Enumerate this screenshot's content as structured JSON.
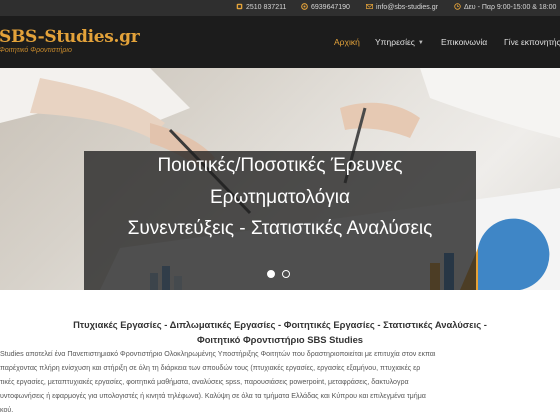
{
  "topbar": {
    "phone1": "2510 837211",
    "phone2": "6939647190",
    "email": "info@sbs-studies.gr",
    "hours": "Δευ - Παρ 9:00-15:00 & 18:00",
    "icons": [
      "phone-icon",
      "whatsapp-icon",
      "mail-icon",
      "clock-icon"
    ]
  },
  "logo": {
    "title": "SBS-Studies.gr",
    "subtitle": "Φοιτητικό Φροντιστήριο"
  },
  "nav": {
    "items": [
      {
        "label": "Αρχική",
        "active": true
      },
      {
        "label": "Υπηρεσίες",
        "dropdown": true
      },
      {
        "label": "Επικοινωνία"
      },
      {
        "label": "Γίνε εκπονητής"
      }
    ]
  },
  "hero": {
    "lines": [
      "Ποιοτικές/Ποσοτικές Έρευνες",
      "Ερωτηματολόγια",
      "Συνεντεύξεις - Στατιστικές Αναλύσεις"
    ],
    "slide_count": 2,
    "active_slide": 1
  },
  "content": {
    "headline_line1": "Πτυχιακές Εργασίες - Διπλωματικές Εργασίες - Φοιτητικές Εργασίες - Στατιστικές Αναλύσεις -",
    "headline_line2": "Φοιτητικό Φροντιστήριο SBS Studies",
    "paragraph": [
      "Studies αποτελεί ένα Πανεπιστημιακό Φροντιστήριο Ολοκληρωμένης Υποστήριξης Φοιτητών που δραστηριοποιείται με επιτυχία στον εκπαι",
      "παρέχοντας πλήρη ενίσχυση και στήριξη σε όλη τη διάρκεια των σπουδών τους (πτυχιακές εργασίες, εργασίες εξαμήνου, πτυχιακές ερ",
      "τικές εργασίες, μεταπτυχιακές εργασίες, φοιτητικά μαθήματα, αναλύσεις spss, παρουσιάσεις powerpoint, μεταφράσεις, δακτυλογρα",
      "υντοφωνήσεις ή εφαρμογές για υπολογιστές ή κινητά τηλέφωνα). Καλύψη σε όλα τα τμήματα Ελλάδας και Κύπρου και επιλεγμένα τμήμα",
      "κού."
    ]
  },
  "colors": {
    "accent": "#e3a23a",
    "topbar_bg": "#2f2f2f",
    "header_bg": "#1c1c1c",
    "caption_bg": "#202020"
  }
}
